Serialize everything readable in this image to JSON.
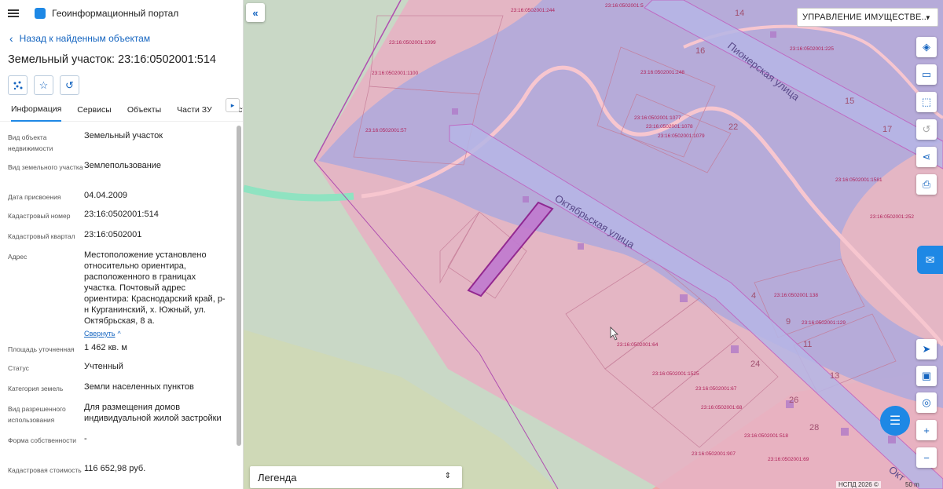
{
  "app": {
    "title": "Геоинформационный портал"
  },
  "nav": {
    "back_label": "Назад к найденным объектам"
  },
  "object": {
    "title": "Земельный участок: 23:16:0502001:514"
  },
  "tabs": [
    "Информация",
    "Сервисы",
    "Объекты",
    "Части ЗУ",
    "Соста"
  ],
  "properties": [
    {
      "label": "Вид объекта недвижимости",
      "value": "Земельный участок"
    },
    {
      "label": "Вид земельного участка",
      "value": "Землепользование"
    },
    {
      "label": "Дата присвоения",
      "value": "04.04.2009"
    },
    {
      "label": "Кадастровый номер",
      "value": "23:16:0502001:514"
    },
    {
      "label": "Кадастровый квартал",
      "value": "23:16:0502001"
    },
    {
      "label": "Адрес",
      "value": "Местоположение установлено относительно ориентира, расположенного в границах участка. Почтовый адрес ориентира: Краснодарский край, р-н Курганинский, х. Южный, ул. Октябрьская, 8 а."
    },
    {
      "label": "Площадь уточненная",
      "value": "1 462 кв. м"
    },
    {
      "label": "Статус",
      "value": "Учтенный"
    },
    {
      "label": "Категория земель",
      "value": "Земли населенных пунктов"
    },
    {
      "label": "Вид разрешенного использования",
      "value": "Для размещения домов индивидуальной жилой застройки"
    },
    {
      "label": "Форма собственности",
      "value": "-"
    },
    {
      "label": "Кадастровая стоимость",
      "value": "116 652,98 руб."
    }
  ],
  "address_collapse": "Свернуть",
  "map": {
    "layer_select": "УПРАВЛЕНИЕ ИМУЩЕСТВЕ...",
    "legend_label": "Легенда",
    "copyright": "НСПД 2026 ©",
    "scale": "50 m",
    "streets": [
      "Октябрьская улица",
      "Пионерская улица",
      "Окт"
    ],
    "parcel_labels": [
      "23:16:0502001:244",
      "23:16:0502001:5",
      "23:16:0502001:1099",
      "23:16:0502001:1100",
      "23:16:0502001:57",
      "23:16:0502001:225",
      "23:16:0502001:248",
      "23:16:0502001:1077",
      "23:16:0502001:1078",
      "23:16:0502001:1079",
      "23:16:0502001:1581",
      "23:16:0502001:252",
      "23:16:0502001:138",
      "23:16:0502001:129",
      "23:16:0502001:64",
      "23:16:0502001:1525",
      "23:16:0502001:67",
      "23:16:0502001:68",
      "23:16:0502001:518",
      "23:16:0502001:907",
      "23:16:0502001:69"
    ],
    "house_numbers": [
      "16",
      "15",
      "17",
      "22",
      "4",
      "9",
      "11",
      "13",
      "24",
      "26",
      "28",
      "14"
    ]
  },
  "colors": {
    "accent": "#1e88e5",
    "parcel_pink": "#e8b4c4",
    "zone_blue": "#a9a8e0",
    "selected": "#8b1a8b"
  }
}
